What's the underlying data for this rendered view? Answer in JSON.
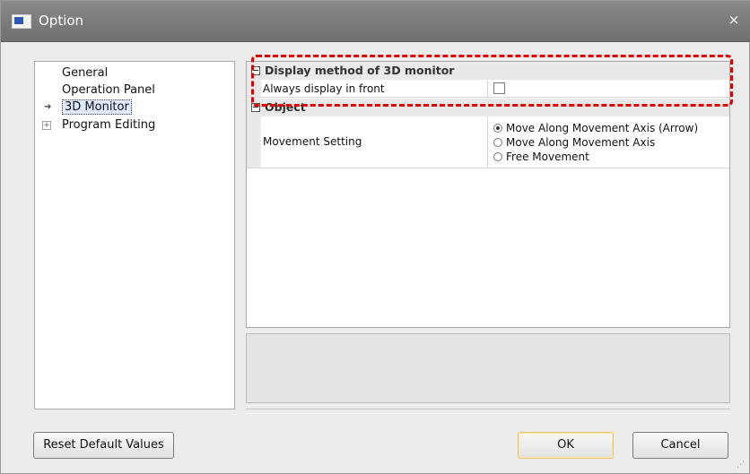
{
  "window": {
    "title": "Option",
    "close_glyph": "×"
  },
  "tree": {
    "items": [
      {
        "label": "General",
        "icon": "none"
      },
      {
        "label": "Operation Panel",
        "icon": "none"
      },
      {
        "label": "3D Monitor",
        "icon": "arrow-right-icon",
        "selected": true
      },
      {
        "label": "Program Editing",
        "icon": "expand-plus-icon"
      }
    ],
    "arrow_glyph": "➔",
    "plus_glyph": "+"
  },
  "properties": {
    "categories": [
      {
        "label": "Display method of 3D monitor",
        "rows": [
          {
            "name": "Always display in front",
            "value": false
          }
        ]
      },
      {
        "label": "Object",
        "rows": [
          {
            "name": "Movement Setting",
            "options": [
              {
                "label": "Move Along Movement Axis (Arrow)",
                "selected": true
              },
              {
                "label": "Move Along Movement Axis",
                "selected": false
              },
              {
                "label": "Free Movement",
                "selected": false
              }
            ]
          }
        ]
      }
    ]
  },
  "buttons": {
    "reset": "Reset Default Values",
    "ok": "OK",
    "cancel": "Cancel"
  },
  "colors": {
    "highlight": "#e00000",
    "titlebar": "#7d7d7d",
    "default_button_border": "#e8c36a"
  }
}
